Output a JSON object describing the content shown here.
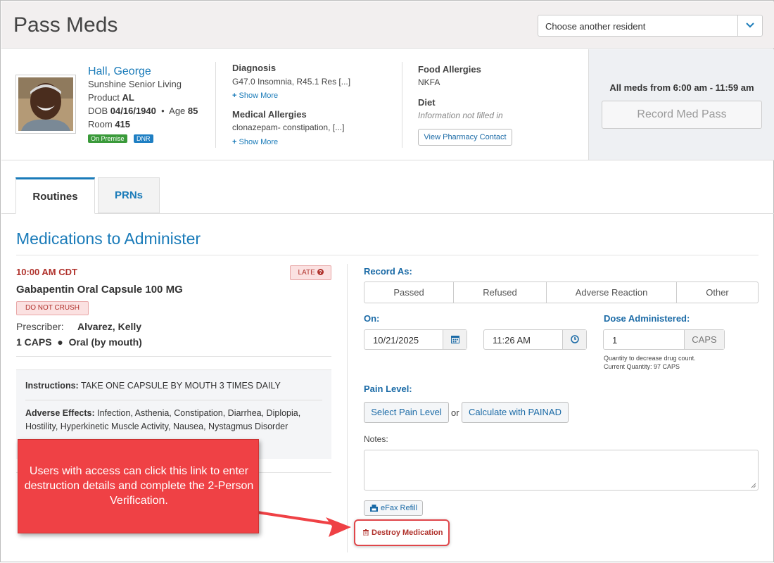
{
  "header": {
    "title": "Pass Meds",
    "resident_select": "Choose another resident"
  },
  "resident": {
    "name": "Hall, George",
    "facility": "Sunshine Senior Living",
    "product_label": "Product",
    "product": "AL",
    "dob_label": "DOB",
    "dob": "04/16/1940",
    "age_label": "Age",
    "age": "85",
    "room_label": "Room",
    "room": "415",
    "badges": [
      "On Premise",
      "DNR"
    ],
    "diagnosis_label": "Diagnosis",
    "diagnosis": "G47.0 Insomnia, R45.1 Res [...]",
    "show_more": "Show More",
    "medical_allergies_label": "Medical Allergies",
    "medical_allergies": "clonazepam- constipation, [...]",
    "food_allergies_label": "Food Allergies",
    "food_allergies": "NKFA",
    "diet_label": "Diet",
    "diet": "Information not filled in",
    "pharmacy_button": "View Pharmacy Contact"
  },
  "side": {
    "window": "All meds from 6:00 am - 11:59 am",
    "record_button": "Record Med Pass"
  },
  "tabs": [
    {
      "label": "Routines",
      "active": true
    },
    {
      "label": "PRNs",
      "active": false
    }
  ],
  "section_title": "Medications to Administer",
  "medication": {
    "time": "10:00 AM CDT",
    "late_badge": "LATE",
    "name": "Gabapentin Oral Capsule 100 MG",
    "warning": "DO NOT CRUSH",
    "prescriber_label": "Prescriber:",
    "prescriber": "Alvarez, Kelly",
    "dose_qty": "1 CAPS",
    "route": "Oral (by mouth)",
    "instructions_label": "Instructions:",
    "instructions": "TAKE ONE CAPSULE BY MOUTH 3 TIMES DAILY",
    "adverse_label": "Adverse Effects:",
    "adverse": "Infection, Asthenia, Constipation, Diarrhea, Diplopia, Hostility, Hyperkinetic Muscle Activity, Nausea, Nystagmus Disorder"
  },
  "form": {
    "record_as_label": "Record As:",
    "record_options": [
      "Passed",
      "Refused",
      "Adverse Reaction",
      "Other"
    ],
    "on_label": "On:",
    "date": "10/21/2025",
    "time": "11:26 AM",
    "dose_label": "Dose Administered:",
    "dose": "1",
    "dose_unit": "CAPS",
    "qty_note_1": "Quantity to decrease drug count.",
    "qty_note_2": "Current Quantity: 97 CAPS",
    "pain_label": "Pain Level:",
    "pain_select": "Select Pain Level",
    "or": "or",
    "painad": "Calculate with PAINAD",
    "notes_label": "Notes:",
    "efax": "eFax Refill",
    "destroy": "Destroy Medication"
  },
  "callout": {
    "text": "Users with access can click this link to enter destruction details and complete the 2-Person Verification."
  },
  "colors": {
    "accent": "#1a7bb9",
    "danger": "#b0322c",
    "callout": "#ef4145",
    "badge_green": "#3a9a3a",
    "badge_blue": "#1f7fc3"
  }
}
